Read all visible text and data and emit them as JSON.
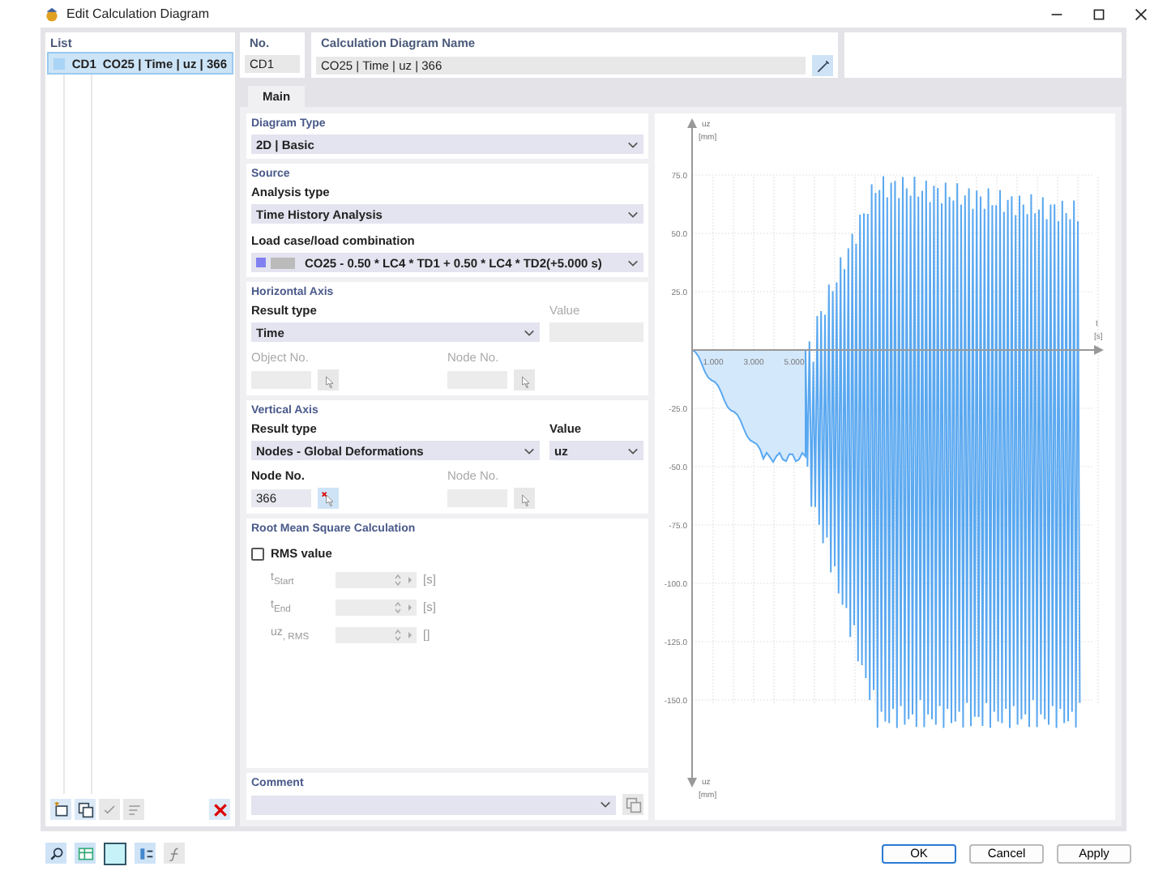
{
  "window": {
    "title": "Edit Calculation Diagram"
  },
  "list": {
    "title": "List",
    "items": [
      {
        "id": "CD1",
        "name": "CO25 | Time | uz | 366",
        "color": "#a9d4f5",
        "selected": true
      }
    ]
  },
  "header": {
    "no_label": "No.",
    "no_value": "CD1",
    "name_label": "Calculation Diagram Name",
    "name_value": "CO25 | Time | uz | 366"
  },
  "tabs": [
    {
      "label": "Main",
      "selected": true
    }
  ],
  "diagram_type": {
    "title": "Diagram Type",
    "value": "2D | Basic"
  },
  "source": {
    "title": "Source",
    "analysis_label": "Analysis type",
    "analysis_value": "Time History Analysis",
    "load_label": "Load case/load combination",
    "load_value": "CO25 - 0.50 * LC4 * TD1 + 0.50 * LC4 * TD2(+5.000 s)"
  },
  "horizontal_axis": {
    "title": "Horizontal Axis",
    "result_label": "Result type",
    "result_value": "Time",
    "value_label": "Value",
    "value_disabled": true,
    "object_label": "Object No.",
    "object_disabled": true,
    "node_label": "Node No.",
    "node_disabled": true
  },
  "vertical_axis": {
    "title": "Vertical Axis",
    "result_label": "Result type",
    "result_value": "Nodes - Global Deformations",
    "value_label": "Value",
    "value_value": "uz",
    "node_label": "Node No.",
    "node_value": "366",
    "node_disabled": false,
    "node2_label": "Node No.",
    "node2_disabled": true
  },
  "rms": {
    "title": "Root Mean Square Calculation",
    "checkbox_label": "RMS value",
    "checked": false,
    "rows": [
      {
        "label": "t$_{Start}$",
        "unit": "[s]"
      },
      {
        "label": "t$_{End}$",
        "unit": "[s]"
      },
      {
        "label": "uz$_{, RMS}$",
        "unit": "[]"
      }
    ]
  },
  "comment": {
    "title": "Comment"
  },
  "chart": {
    "y_label": "uz",
    "y_unit": "[mm]",
    "x_label": "t",
    "x_unit": "[s]",
    "y_label_bottom": "uz",
    "y_unit_bottom": "[mm]",
    "y_ticks": [
      "75.0",
      "50.0",
      "25.0",
      "-25.0",
      "-50.0",
      "-75.0",
      "-100.0",
      "-125.0",
      "-150.0"
    ],
    "x_ticks": [
      "1.000",
      "3.000",
      "5.000"
    ]
  },
  "buttons": [
    {
      "label": "OK",
      "default": true
    },
    {
      "label": "Cancel",
      "default": false
    },
    {
      "label": "Apply",
      "default": false
    }
  ]
}
